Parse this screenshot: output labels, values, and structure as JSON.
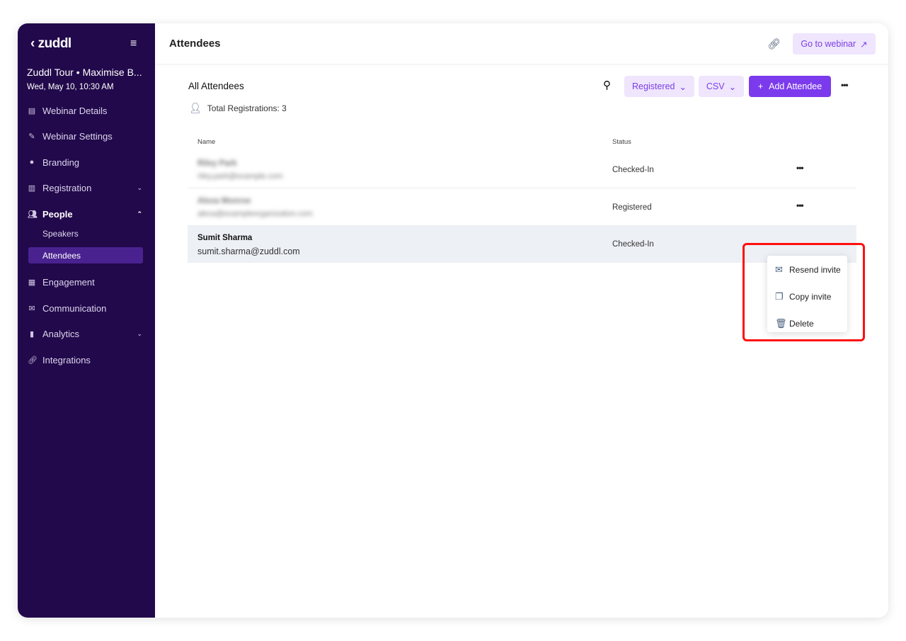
{
  "sidebar": {
    "logo": "zuddl",
    "event_title": "Zuddl Tour • Maximise B...",
    "event_date": "Wed, May 10, 10:30 AM",
    "items": [
      {
        "label": "Webinar Details"
      },
      {
        "label": "Webinar Settings"
      },
      {
        "label": "Branding"
      },
      {
        "label": "Registration"
      },
      {
        "label": "People"
      },
      {
        "label": "Engagement"
      },
      {
        "label": "Communication"
      },
      {
        "label": "Analytics"
      },
      {
        "label": "Integrations"
      }
    ],
    "people_sub": [
      {
        "label": "Speakers"
      },
      {
        "label": "Attendees"
      }
    ]
  },
  "header": {
    "title": "Attendees",
    "go_to_webinar": "Go to webinar"
  },
  "section": {
    "title": "All Attendees",
    "total": "Total Registrations: 3",
    "filter": "Registered",
    "export": "CSV",
    "add": "Add Attendee"
  },
  "table": {
    "headers": {
      "name": "Name",
      "status": "Status"
    },
    "rows": [
      {
        "name": "Riley Park",
        "email": "riley.park@example.com",
        "status": "Checked-In"
      },
      {
        "name": "Alexa Monroe",
        "email": "alexa@exampleorganization.com",
        "status": "Registered"
      },
      {
        "name": "Sumit Sharma",
        "email": "sumit.sharma@zuddl.com",
        "status": "Checked-In"
      }
    ]
  },
  "context_menu": {
    "items": [
      {
        "label": "Resend invite"
      },
      {
        "label": "Copy invite"
      },
      {
        "label": "Delete"
      }
    ]
  },
  "colors": {
    "sidebar": "#22094b",
    "accent": "#7c3aed",
    "highlight": "#ff0f0f"
  }
}
